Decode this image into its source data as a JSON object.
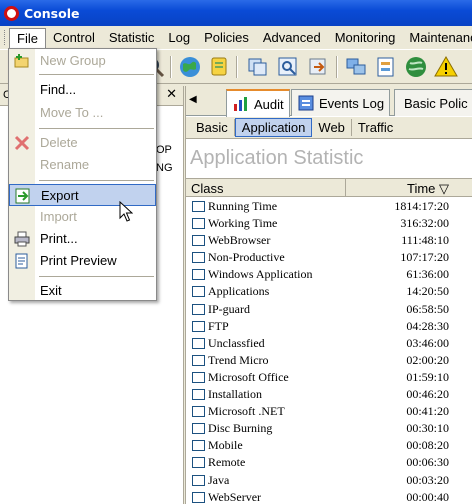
{
  "window": {
    "title": "Console"
  },
  "menubar": {
    "items": [
      {
        "label": "File"
      },
      {
        "label": "Control"
      },
      {
        "label": "Statistic"
      },
      {
        "label": "Log"
      },
      {
        "label": "Policies"
      },
      {
        "label": "Advanced"
      },
      {
        "label": "Monitoring"
      },
      {
        "label": "Maintenance"
      }
    ]
  },
  "file_menu": {
    "items": [
      {
        "label": "New Group",
        "enabled": false,
        "icon": "new-group-icon"
      },
      {
        "label": "Find...",
        "enabled": true
      },
      {
        "label": "Move To ...",
        "enabled": false
      },
      {
        "label": "Delete",
        "enabled": false,
        "icon": "delete-icon"
      },
      {
        "label": "Rename",
        "enabled": false
      },
      {
        "label": "Export",
        "enabled": true,
        "highlighted": true,
        "icon": "export-icon"
      },
      {
        "label": "Import",
        "enabled": false
      },
      {
        "label": "Print...",
        "enabled": true,
        "icon": "printer-icon"
      },
      {
        "label": "Print Preview",
        "enabled": true,
        "icon": "print-preview-icon"
      },
      {
        "label": "Exit",
        "enabled": true
      }
    ]
  },
  "left_pane": {
    "header_fragment": "C",
    "text_fragments": [
      "OP",
      "NG"
    ]
  },
  "tabs": [
    {
      "label": "Audit",
      "selected": true,
      "icon": "audit-chart-icon"
    },
    {
      "label": "Events Log",
      "selected": false,
      "icon": "events-log-icon"
    },
    {
      "label": "Basic Polic",
      "selected": false,
      "icon": "basic-policy-icon"
    }
  ],
  "subtabs": [
    {
      "label": "Basic",
      "selected": false
    },
    {
      "label": "Application",
      "selected": true
    },
    {
      "label": "Web",
      "selected": false
    },
    {
      "label": "Traffic",
      "selected": false
    }
  ],
  "content": {
    "heading": "Application Statistic",
    "columns": {
      "class": "Class",
      "time": "Time"
    },
    "sort_indicator": "▽",
    "rows": [
      {
        "name": "Running Time",
        "time": "1814:17:20"
      },
      {
        "name": "Working Time",
        "time": "316:32:00"
      },
      {
        "name": "WebBrowser",
        "time": "111:48:10"
      },
      {
        "name": "Non-Productive",
        "time": "107:17:20"
      },
      {
        "name": "Windows Application",
        "time": "61:36:00"
      },
      {
        "name": "Applications",
        "time": "14:20:50"
      },
      {
        "name": "IP-guard",
        "time": "06:58:50"
      },
      {
        "name": "FTP",
        "time": "04:28:30"
      },
      {
        "name": "Unclassfied",
        "time": "03:46:00"
      },
      {
        "name": "Trend Micro",
        "time": "02:00:20"
      },
      {
        "name": "Microsoft Office",
        "time": "01:59:10"
      },
      {
        "name": "Installation",
        "time": "00:46:20"
      },
      {
        "name": "Microsoft .NET",
        "time": "00:41:20"
      },
      {
        "name": "Disc Burning",
        "time": "00:30:10"
      },
      {
        "name": "Mobile",
        "time": "00:08:20"
      },
      {
        "name": "Remote",
        "time": "00:06:30"
      },
      {
        "name": "Java",
        "time": "00:03:20"
      },
      {
        "name": "WebServer",
        "time": "00:00:40"
      }
    ]
  },
  "colors": {
    "title_bar": "#0a4bd6",
    "menu_highlight": "#c1d2ee",
    "highlight_border": "#316ac5",
    "heading_text": "#b3b3b3"
  }
}
